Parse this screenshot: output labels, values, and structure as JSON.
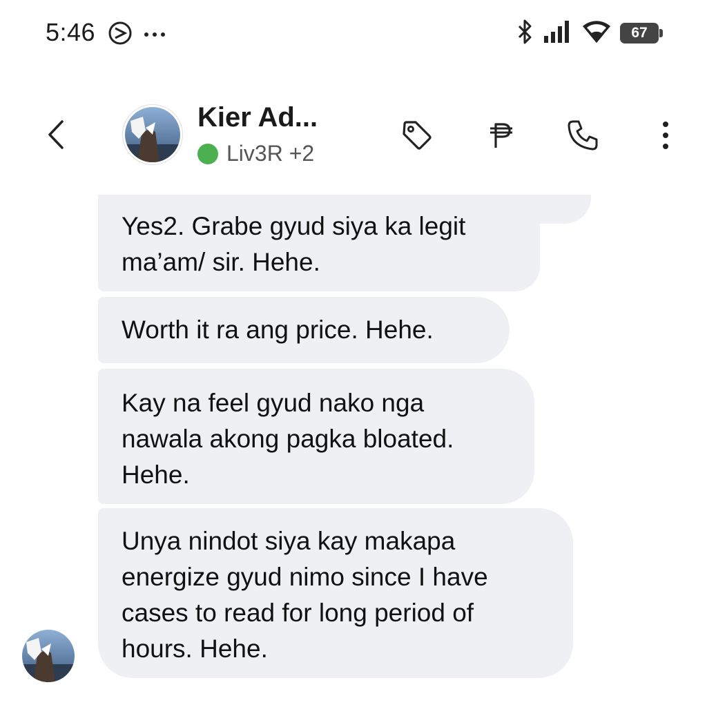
{
  "status_bar": {
    "time": "5:46",
    "icons": [
      "do-not-disturb-icon",
      "more-dots-icon",
      "bluetooth-icon",
      "signal-icon",
      "wifi-icon"
    ],
    "battery": "67"
  },
  "header": {
    "contact_name": "Kier Ad...",
    "status_label": "Liv3R +2",
    "status_color": "#4caf50",
    "actions": [
      "tag-icon",
      "peso-icon",
      "phone-icon",
      "more-vertical-icon"
    ]
  },
  "messages": [
    {
      "text": "Yes2. Grabe gyud siya ka legit ma’am/ sir. Hehe."
    },
    {
      "text": "Worth it ra ang price. Hehe."
    },
    {
      "text": "Kay na feel gyud nako nga nawala akong pagka bloated. Hehe."
    },
    {
      "text": "Unya nindot siya kay makapa energize gyud nimo since I have cases to read for long period of hours. Hehe."
    }
  ],
  "colors": {
    "bubble_bg": "#eff0f4",
    "text": "#111111",
    "online": "#4caf50"
  }
}
